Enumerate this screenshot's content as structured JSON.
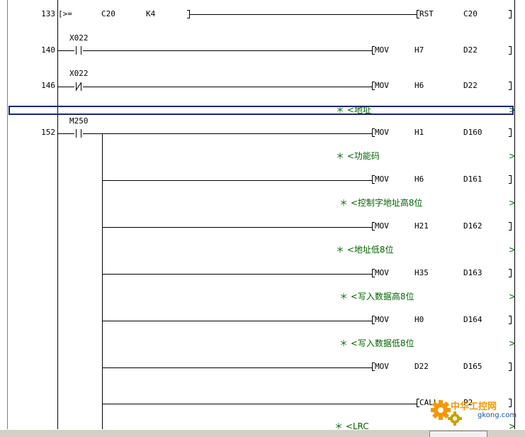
{
  "rungs": [
    {
      "step": "133",
      "compare": {
        "op": "[>=",
        "s1": "C20",
        "s2": "K4"
      },
      "instruction": {
        "op": "RST",
        "d": "C20"
      }
    },
    {
      "step": "140",
      "contact": {
        "device": "X022",
        "type": "NO"
      },
      "instruction": {
        "op": "MOV",
        "s": "H7",
        "d": "D22"
      }
    },
    {
      "step": "146",
      "contact": {
        "device": "X022",
        "type": "NC"
      },
      "instruction": {
        "op": "MOV",
        "s": "H6",
        "d": "D22"
      }
    },
    {
      "comment": "＊ <地址"
    },
    {
      "step": "152",
      "contact": {
        "device": "M250",
        "type": "NO"
      },
      "branches": [
        {
          "instruction": {
            "op": "MOV",
            "s": "H1",
            "d": "D160"
          },
          "comment": "＊ <功能码"
        },
        {
          "instruction": {
            "op": "MOV",
            "s": "H6",
            "d": "D161"
          },
          "comment": "＊ <控制字地址高8位"
        },
        {
          "instruction": {
            "op": "MOV",
            "s": "H21",
            "d": "D162"
          },
          "comment": "＊ <地址低8位"
        },
        {
          "instruction": {
            "op": "MOV",
            "s": "H35",
            "d": "D163"
          },
          "comment": "＊ <写入数据高8位"
        },
        {
          "instruction": {
            "op": "MOV",
            "s": "H0",
            "d": "D164"
          },
          "comment": "＊ <写入数据低8位"
        },
        {
          "instruction": {
            "op": "MOV",
            "s": "D22",
            "d": "D165"
          }
        },
        {
          "instruction": {
            "op": "CALL",
            "s": "P2"
          },
          "comment": "＊ <LRC"
        }
      ]
    }
  ],
  "watermark": {
    "cn": "中华工控网",
    "url": "gkong.com"
  },
  "colors": {
    "comment": "#006400",
    "cursor": "#1a237e",
    "rail": "#000000",
    "statusbar": "#d4d0c8",
    "watermark": "#f39800"
  }
}
